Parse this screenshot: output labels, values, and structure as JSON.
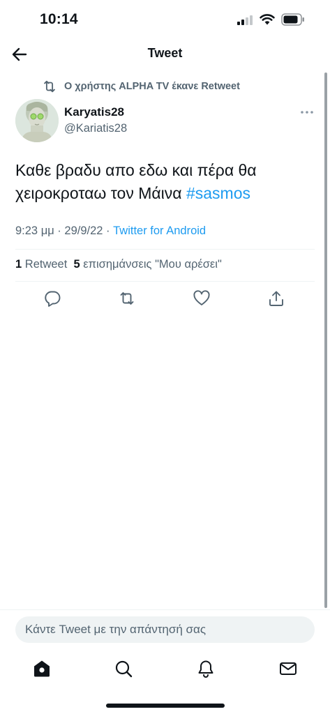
{
  "status_bar": {
    "time": "10:14"
  },
  "header": {
    "title": "Tweet"
  },
  "retweet_context": {
    "text": "Ο χρήστης ALPHA TV έκανε Retweet"
  },
  "author": {
    "name": "Karyatis28",
    "handle": "@Kariatis28"
  },
  "tweet": {
    "text": "Καθε βραδυ απο εδω και πέρα θα χειροκροταω τον Μάινα ",
    "hashtag": "#sasmos",
    "time": "9:23 μμ",
    "date": "29/9/22",
    "separator": " · ",
    "source": "Twitter for Android"
  },
  "stats": {
    "retweets_count": "1",
    "retweets_label": "Retweet",
    "likes_count": "5",
    "likes_label": "επισημάνσεις \"Μου αρέσει\""
  },
  "reply": {
    "placeholder": "Κάντε Tweet με την απάντησή σας"
  },
  "colors": {
    "accent": "#1d9bf0",
    "secondary_text": "#536471",
    "primary_text": "#0f1419"
  },
  "icons": {
    "back": "arrow-left-icon",
    "retweet": "retweet-icon",
    "more": "more-horizontal-icon",
    "reply": "reply-icon",
    "like": "heart-icon",
    "share": "share-icon",
    "home": "home-icon",
    "search": "search-icon",
    "notifications": "bell-icon",
    "messages": "envelope-icon"
  }
}
